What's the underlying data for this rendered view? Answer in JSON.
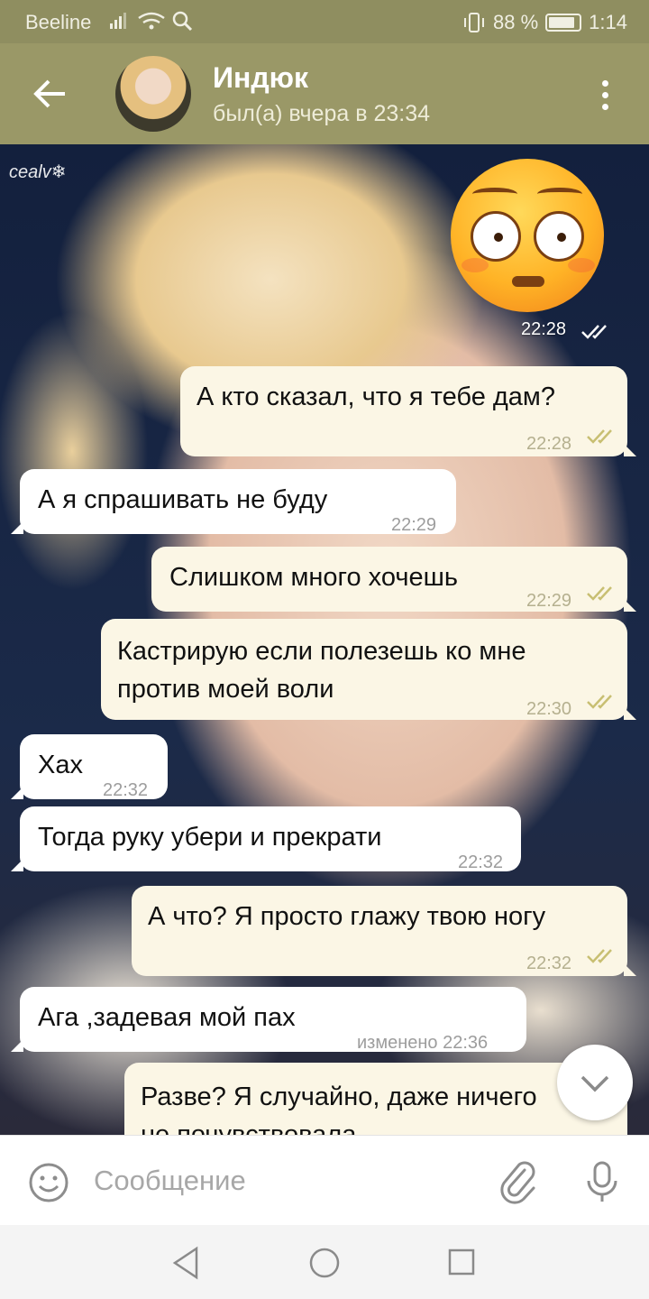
{
  "status_bar": {
    "carrier": "Beeline",
    "battery": "88 %",
    "time": "1:14",
    "battery_level": 0.88
  },
  "header": {
    "back_icon": "arrow-left-icon",
    "title": "Индюк",
    "subtitle": "был(а) вчера в 23:34",
    "menu_icon": "more-vertical-icon"
  },
  "wallpaper": {
    "watermark": "cealv❄"
  },
  "messages": [
    {
      "type": "sticker",
      "direction": "out",
      "sticker": "flushed-face-emoji",
      "time": "22:28",
      "read": true
    },
    {
      "direction": "out",
      "text": "А кто сказал, что я тебе дам?",
      "time": "22:28",
      "read": true
    },
    {
      "direction": "in",
      "text": "А я спрашивать не буду",
      "time": "22:29"
    },
    {
      "direction": "out",
      "text": "Слишком много хочешь",
      "time": "22:29",
      "read": true
    },
    {
      "direction": "out",
      "lines": [
        "Кастрирую если полезешь ко мне",
        "против моей воли"
      ],
      "time": "22:30",
      "read": true
    },
    {
      "direction": "in",
      "text": "Хах",
      "time": "22:32"
    },
    {
      "direction": "in",
      "text": "Тогда руку убери и прекрати",
      "time": "22:32"
    },
    {
      "direction": "out",
      "text": "А что? Я просто глажу твою ногу",
      "time": "22:32",
      "read": true
    },
    {
      "direction": "in",
      "text": "Ага ,задевая мой пах",
      "time": "изменено 22:36"
    },
    {
      "direction": "out",
      "lines": [
        "Разве? Я случайно, даже ничего",
        "не почувствовала"
      ],
      "time": ""
    }
  ],
  "scroll_down_icon": "chevron-down-icon",
  "composer": {
    "emoji_icon": "smile-icon",
    "placeholder": "Сообщение",
    "attach_icon": "paperclip-icon",
    "mic_icon": "microphone-icon"
  },
  "nav": {
    "back": "triangle-back-icon",
    "home": "circle-home-icon",
    "recents": "square-recents-icon"
  },
  "colors": {
    "header": "#9a9867",
    "status_bar": "#8f8e60",
    "outgoing_bubble": "#fbf6e5",
    "incoming_bubble": "#ffffff",
    "check": "#c8bf72"
  }
}
